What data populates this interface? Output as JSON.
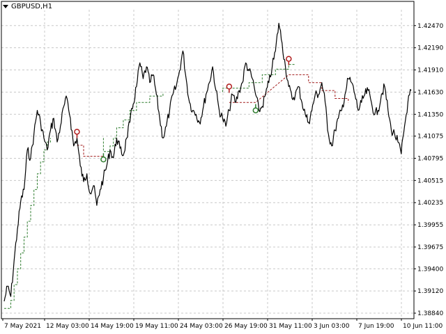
{
  "chart_header": {
    "symbol": "GBPUSD,H1",
    "menu_icon": "triangle-down-icon"
  },
  "colors": {
    "background": "#ffffff",
    "grid": "#c8c8c8",
    "price": "#000000",
    "buy_line": "#2f7d2f",
    "sell_line": "#a01818",
    "buy_marker": "#2f7d2f",
    "sell_marker": "#b01c1c"
  },
  "chart_data": {
    "type": "line",
    "title": "GBPUSD,H1",
    "xlabel": "",
    "ylabel": "",
    "ylim": [
      1.3877,
      1.4267
    ],
    "grid": true,
    "y_ticks": [
      "1.42470",
      "1.42190",
      "1.41910",
      "1.41630",
      "1.41350",
      "1.41075",
      "1.40795",
      "1.40515",
      "1.40235",
      "1.39955",
      "1.39675",
      "1.39400",
      "1.39120",
      "1.38840"
    ],
    "x_ticks": [
      "7 May 2021",
      "12 May 03:00",
      "14 May 19:00",
      "19 May 11:00",
      "24 May 03:00",
      "26 May 19:00",
      "31 May 11:00",
      "3 Jun 03:00",
      "7 Jun 19:00",
      "10 Jun 11:00"
    ],
    "series": [
      {
        "name": "",
        "values": [
          [
            0,
            1.3899
          ],
          [
            1,
            1.3918
          ],
          [
            2,
            1.3905
          ],
          [
            3,
            1.395
          ],
          [
            4,
            1.399
          ],
          [
            5,
            1.4025
          ],
          [
            6,
            1.404
          ],
          [
            7,
            1.409
          ],
          [
            8,
            1.408
          ],
          [
            9,
            1.411
          ],
          [
            10,
            1.414
          ],
          [
            11,
            1.4125
          ],
          [
            12,
            1.4105
          ],
          [
            13,
            1.409
          ],
          [
            14,
            1.4115
          ],
          [
            15,
            1.413
          ],
          [
            16,
            1.41
          ],
          [
            17,
            1.412
          ],
          [
            18,
            1.4145
          ],
          [
            19,
            1.4155
          ],
          [
            20,
            1.413
          ],
          [
            21,
            1.4095
          ],
          [
            22,
            1.4105
          ],
          [
            23,
            1.407
          ],
          [
            24,
            1.405
          ],
          [
            25,
            1.406
          ],
          [
            26,
            1.4035
          ],
          [
            27,
            1.4045
          ],
          [
            28,
            1.402
          ],
          [
            29,
            1.404
          ],
          [
            30,
            1.4055
          ],
          [
            31,
            1.407
          ],
          [
            32,
            1.409
          ],
          [
            33,
            1.408
          ],
          [
            34,
            1.4105
          ],
          [
            35,
            1.4092
          ],
          [
            36,
            1.4083
          ],
          [
            37,
            1.4105
          ],
          [
            38,
            1.4125
          ],
          [
            39,
            1.4148
          ],
          [
            40,
            1.417
          ],
          [
            41,
            1.42
          ],
          [
            42,
            1.418
          ],
          [
            43,
            1.4195
          ],
          [
            44,
            1.4175
          ],
          [
            45,
            1.4185
          ],
          [
            46,
            1.416
          ],
          [
            47,
            1.413
          ],
          [
            48,
            1.4105
          ],
          [
            49,
            1.412
          ],
          [
            50,
            1.414
          ],
          [
            51,
            1.416
          ],
          [
            52,
            1.417
          ],
          [
            53,
            1.419
          ],
          [
            54,
            1.4215
          ],
          [
            55,
            1.418
          ],
          [
            56,
            1.415
          ],
          [
            57,
            1.414
          ],
          [
            58,
            1.4135
          ],
          [
            59,
            1.4125
          ],
          [
            60,
            1.414
          ],
          [
            61,
            1.416
          ],
          [
            62,
            1.4175
          ],
          [
            63,
            1.4195
          ],
          [
            64,
            1.4165
          ],
          [
            65,
            1.414
          ],
          [
            66,
            1.413
          ],
          [
            67,
            1.412
          ],
          [
            68,
            1.414
          ],
          [
            69,
            1.416
          ],
          [
            70,
            1.415
          ],
          [
            71,
            1.4165
          ],
          [
            72,
            1.4175
          ],
          [
            73,
            1.42
          ],
          [
            74,
            1.419
          ],
          [
            75,
            1.418
          ],
          [
            76,
            1.416
          ],
          [
            77,
            1.414
          ],
          [
            78,
            1.4145
          ],
          [
            79,
            1.416
          ],
          [
            80,
            1.4175
          ],
          [
            81,
            1.4195
          ],
          [
            82,
            1.4215
          ],
          [
            83,
            1.425
          ],
          [
            84,
            1.4225
          ],
          [
            85,
            1.4195
          ],
          [
            86,
            1.417
          ],
          [
            87,
            1.4155
          ],
          [
            88,
            1.416
          ],
          [
            89,
            1.417
          ],
          [
            90,
            1.415
          ],
          [
            91,
            1.4135
          ],
          [
            92,
            1.4125
          ],
          [
            93,
            1.414
          ],
          [
            94,
            1.416
          ],
          [
            95,
            1.416
          ],
          [
            96,
            1.4175
          ],
          [
            97,
            1.415
          ],
          [
            98,
            1.411
          ],
          [
            99,
            1.4095
          ],
          [
            100,
            1.4115
          ],
          [
            101,
            1.413
          ],
          [
            102,
            1.414
          ],
          [
            103,
            1.416
          ],
          [
            104,
            1.418
          ],
          [
            105,
            1.4175
          ],
          [
            106,
            1.416
          ],
          [
            107,
            1.414
          ],
          [
            108,
            1.415
          ],
          [
            109,
            1.416
          ],
          [
            110,
            1.4165
          ],
          [
            111,
            1.415
          ],
          [
            112,
            1.4135
          ],
          [
            113,
            1.414
          ],
          [
            114,
            1.416
          ],
          [
            115,
            1.417
          ],
          [
            116,
            1.414
          ],
          [
            117,
            1.4115
          ],
          [
            118,
            1.411
          ],
          [
            119,
            1.41
          ],
          [
            120,
            1.4085
          ],
          [
            121,
            1.412
          ],
          [
            122,
            1.415
          ],
          [
            123,
            1.4165
          ]
        ]
      }
    ],
    "buy_levels": [
      [
        0,
        1.389
      ],
      [
        2,
        1.389
      ],
      [
        2,
        1.39
      ],
      [
        3,
        1.39
      ],
      [
        3,
        1.392
      ],
      [
        4,
        1.392
      ],
      [
        4,
        1.394
      ],
      [
        5,
        1.394
      ],
      [
        5,
        1.396
      ],
      [
        6,
        1.396
      ],
      [
        6,
        1.398
      ],
      [
        7,
        1.398
      ],
      [
        7,
        1.4
      ],
      [
        8,
        1.4
      ],
      [
        8,
        1.402
      ],
      [
        9,
        1.402
      ],
      [
        9,
        1.404
      ],
      [
        10,
        1.404
      ],
      [
        10,
        1.406
      ],
      [
        11,
        1.406
      ],
      [
        11,
        1.4075
      ],
      [
        12,
        1.4075
      ],
      [
        12,
        1.409
      ],
      [
        13,
        1.409
      ],
      [
        13,
        1.41
      ],
      [
        14,
        1.41
      ],
      [
        14,
        1.4105
      ],
      [
        30,
        1.4105
      ],
      [
        30,
        1.4088
      ],
      [
        32,
        1.4088
      ],
      [
        32,
        1.4095
      ],
      [
        33,
        1.4095
      ],
      [
        33,
        1.4105
      ],
      [
        34,
        1.4105
      ],
      [
        34,
        1.4118
      ],
      [
        36,
        1.4118
      ],
      [
        36,
        1.4128
      ],
      [
        38,
        1.4128
      ],
      [
        38,
        1.414
      ],
      [
        40,
        1.414
      ],
      [
        40,
        1.415
      ],
      [
        44,
        1.415
      ],
      [
        44,
        1.4158
      ],
      [
        48,
        1.4158
      ],
      [
        48,
        1.4163
      ],
      [
        66,
        1.4163
      ],
      [
        66,
        1.4168
      ],
      [
        74,
        1.4168
      ],
      [
        74,
        1.4175
      ],
      [
        78,
        1.4175
      ],
      [
        78,
        1.4185
      ],
      [
        82,
        1.4185
      ],
      [
        82,
        1.4192
      ],
      [
        86,
        1.4192
      ],
      [
        86,
        1.4198
      ],
      [
        88,
        1.4198
      ]
    ],
    "sell_levels": [
      [
        22,
        1.4096
      ],
      [
        24,
        1.4096
      ],
      [
        24,
        1.4082
      ],
      [
        30,
        1.4082
      ],
      [
        68,
        1.415
      ],
      [
        76,
        1.415
      ],
      [
        86,
        1.4185
      ],
      [
        92,
        1.4185
      ],
      [
        92,
        1.4175
      ],
      [
        96,
        1.4175
      ],
      [
        96,
        1.4165
      ],
      [
        100,
        1.4165
      ],
      [
        100,
        1.4155
      ],
      [
        104,
        1.4155
      ],
      [
        104,
        1.415
      ],
      [
        123,
        1.415
      ]
    ],
    "buy_signals": [
      [
        30,
        1.4078
      ],
      [
        76,
        1.414
      ]
    ],
    "sell_signals": [
      [
        22,
        1.4113
      ],
      [
        68,
        1.417
      ],
      [
        86,
        1.4205
      ]
    ]
  }
}
